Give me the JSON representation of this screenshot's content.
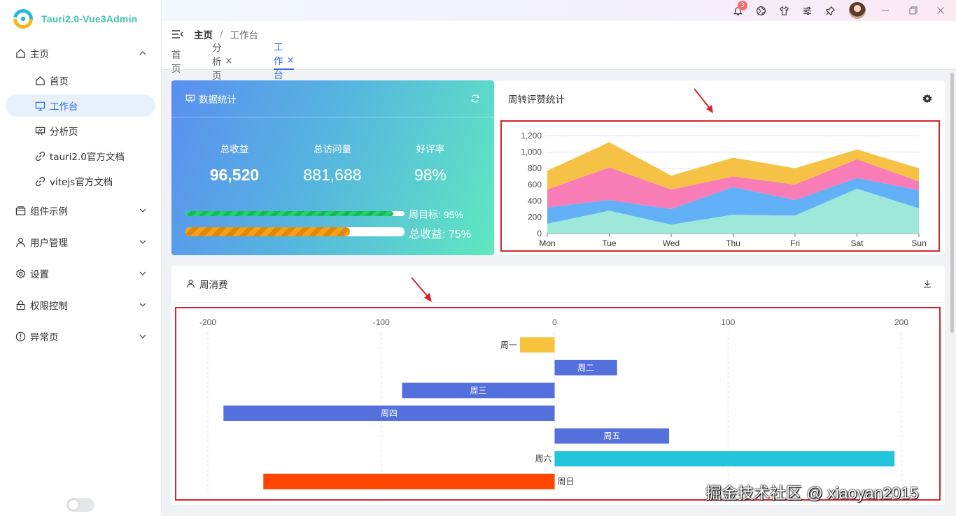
{
  "app": {
    "logo_text": "Tauri2.0-Vue3Admin"
  },
  "sidebar": {
    "items": [
      {
        "label": "主页",
        "icon": "home-icon",
        "expanded": true
      },
      {
        "label": "首页",
        "icon": "home-icon"
      },
      {
        "label": "工作台",
        "icon": "monitor-icon",
        "active": true
      },
      {
        "label": "分析页",
        "icon": "presentation-icon"
      },
      {
        "label": "tauri2.0官方文档",
        "icon": "link-icon"
      },
      {
        "label": "vitejs官方文档",
        "icon": "link-icon"
      },
      {
        "label": "组件示例",
        "icon": "box-icon"
      },
      {
        "label": "用户管理",
        "icon": "user-icon"
      },
      {
        "label": "设置",
        "icon": "gear-icon"
      },
      {
        "label": "权限控制",
        "icon": "lock-icon"
      },
      {
        "label": "异常页",
        "icon": "warning-icon"
      }
    ]
  },
  "topbar": {
    "notification_count": "3"
  },
  "breadcrumb": {
    "items": [
      "主页",
      "/",
      "工作台"
    ]
  },
  "tabs": [
    {
      "label": "首页",
      "closable": false
    },
    {
      "label": "分析页",
      "closable": true,
      "close": "×"
    },
    {
      "label": "工作台",
      "closable": true,
      "close": "×",
      "active": true
    }
  ],
  "stats_card": {
    "title": "数据统计",
    "metrics": [
      {
        "label": "总收益",
        "value": "96,520"
      },
      {
        "label": "总访问量",
        "value": "881,688"
      },
      {
        "label": "好评率",
        "value": "98%"
      }
    ],
    "progress": [
      {
        "label": "周目标: 95%",
        "percent": 95
      },
      {
        "label": "总收益: 75%",
        "percent": 75
      }
    ]
  },
  "rating_card": {
    "title": "周转评赞统计"
  },
  "spend_card": {
    "title": "周消费"
  },
  "watermark": "掘金技术社区 @ xiaoyan2015",
  "chart_data": [
    {
      "type": "area",
      "stacked": true,
      "x": [
        "Mon",
        "Tue",
        "Wed",
        "Thu",
        "Fri",
        "Sat",
        "Sun"
      ],
      "ylim": [
        0,
        1200
      ],
      "yticks": [
        "0",
        "200",
        "400",
        "600",
        "800",
        "1,000",
        "1,200"
      ],
      "grid": true,
      "series": [
        {
          "values": [
            120,
            280,
            110,
            230,
            220,
            550,
            310
          ],
          "color": "#9de8d9"
        },
        {
          "values": [
            200,
            130,
            190,
            340,
            190,
            130,
            220
          ],
          "color": "#62b0f7"
        },
        {
          "values": [
            220,
            400,
            240,
            130,
            190,
            230,
            110
          ],
          "color": "#f87cb6"
        },
        {
          "values": [
            230,
            310,
            170,
            230,
            200,
            120,
            160
          ],
          "color": "#f6c245"
        }
      ]
    },
    {
      "type": "bar",
      "orientation": "horizontal",
      "categories": [
        "周一",
        "周二",
        "周三",
        "周四",
        "周五",
        "周六",
        "周日"
      ],
      "values": [
        -20,
        36,
        -88,
        -191,
        66,
        196,
        -168
      ],
      "colors": [
        "#f8c33c",
        "#5470dc",
        "#5470dc",
        "#5470dc",
        "#5470dc",
        "#22c5d9",
        "#ff4500"
      ],
      "xlim": [
        -200,
        200
      ],
      "xticks": [
        "-200",
        "-100",
        "0",
        "100",
        "200"
      ],
      "grid": true
    }
  ]
}
